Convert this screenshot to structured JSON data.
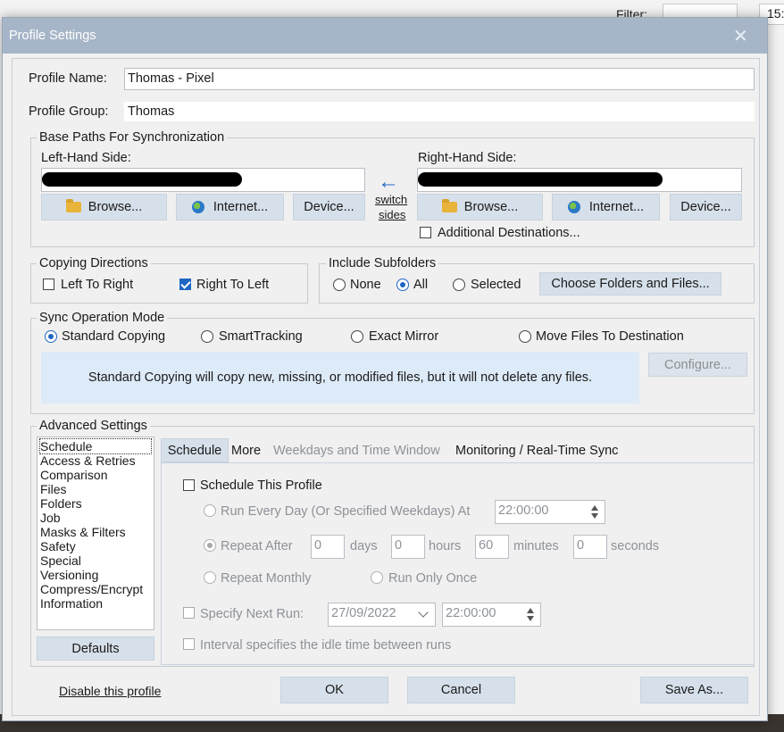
{
  "background_app": {
    "filter_label": "Filter:",
    "time_partial": "15:"
  },
  "dialog": {
    "title": "Profile Settings"
  },
  "profile": {
    "name_label": "Profile Name:",
    "name_value": "Thomas - Pixel",
    "group_label": "Profile Group:",
    "group_value": "Thomas"
  },
  "base_paths": {
    "title": "Base Paths For Synchronization",
    "left_label": "Left-Hand Side:",
    "right_label": "Right-Hand Side:",
    "switch_arrow": "←",
    "switch_line1": "switch",
    "switch_line2": "sides",
    "browse_label": "Browse...",
    "internet_label": "Internet...",
    "device_label": "Device...",
    "additional_destinations": "Additional Destinations..."
  },
  "copying_directions": {
    "title": "Copying Directions",
    "left_to_right": "Left To Right",
    "right_to_left": "Right To Left"
  },
  "include_subfolders": {
    "title": "Include Subfolders",
    "none": "None",
    "all": "All",
    "selected": "Selected",
    "choose_button": "Choose Folders and Files..."
  },
  "sync_mode": {
    "title": "Sync Operation Mode",
    "standard": "Standard Copying",
    "smart": "SmartTracking",
    "exact": "Exact Mirror",
    "move": "Move Files To Destination",
    "description": "Standard Copying will copy new, missing, or modified files, but it will not delete any files.",
    "configure_button": "Configure..."
  },
  "advanced": {
    "title": "Advanced Settings",
    "categories": [
      "Schedule",
      "Access & Retries",
      "Comparison",
      "Files",
      "Folders",
      "Job",
      "Masks & Filters",
      "Safety",
      "Special",
      "Versioning",
      "Compress/Encrypt",
      "Information"
    ],
    "defaults_button": "Defaults",
    "tabs": [
      "Schedule",
      "More",
      "Weekdays and Time Window",
      "Monitoring / Real-Time Sync"
    ]
  },
  "schedule": {
    "schedule_this_profile": "Schedule This Profile",
    "run_every_day": "Run Every Day (Or Specified Weekdays) At",
    "run_every_day_time": "22:00:00",
    "repeat_after": "Repeat After",
    "days_value": "0",
    "days_label": "days",
    "hours_value": "0",
    "hours_label": "hours",
    "minutes_value": "60",
    "minutes_label": "minutes",
    "seconds_value": "0",
    "seconds_label": "seconds",
    "repeat_monthly": "Repeat Monthly",
    "run_only_once": "Run Only Once",
    "specify_next_run": "Specify Next Run:",
    "next_run_date": "27/09/2022",
    "next_run_time": "22:00:00",
    "interval_idle": "Interval specifies the idle time between runs"
  },
  "footer": {
    "disable_link": "Disable this profile",
    "ok": "OK",
    "cancel": "Cancel",
    "save_as": "Save As..."
  }
}
